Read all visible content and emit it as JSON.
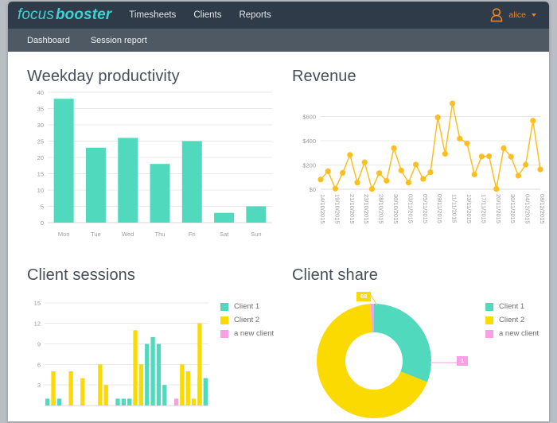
{
  "colors": {
    "teal": "#51d9bd",
    "yellow": "#fada00",
    "pink": "#f99fe6",
    "navbar": "#2f3b49",
    "subnav": "#4e5964",
    "brand": "#3fd0d4",
    "user_accent": "#e8832a",
    "title": "#454f59",
    "grid": "#e8e8e8"
  },
  "header": {
    "logo_first": "focus",
    "logo_second": "booster",
    "nav": [
      {
        "label": "Timesheets"
      },
      {
        "label": "Clients"
      },
      {
        "label": "Reports"
      }
    ],
    "user": {
      "name": "alice",
      "avatar_icon": "user-icon",
      "caret_icon": "chevron-down-icon"
    }
  },
  "subnav": {
    "items": [
      {
        "label": "Dashboard"
      },
      {
        "label": "Session report"
      }
    ]
  },
  "chart_data": [
    {
      "type": "bar",
      "panel": "weekday-productivity",
      "title": "Weekday productivity",
      "categories": [
        "Mon",
        "Tue",
        "Wed",
        "Thu",
        "Fri",
        "Sat",
        "Sun"
      ],
      "values": [
        38,
        23,
        26,
        18,
        25,
        3,
        5
      ],
      "yticks": [
        0,
        5,
        10,
        15,
        20,
        25,
        30,
        35,
        40
      ],
      "ylim": [
        0,
        40
      ],
      "xlabel": "",
      "ylabel": "",
      "color": "#51d9bd",
      "grid": true,
      "legend": "none"
    },
    {
      "type": "line",
      "panel": "revenue",
      "title": "Revenue",
      "x": [
        "14/10/2015",
        "19/10/2015",
        "21/10/2015",
        "23/10/2015",
        "28/10/2015",
        "30/10/2015",
        "03/11/2015",
        "05/11/2015",
        "09/11/2015",
        "11/11/2015",
        "13/11/2015",
        "17/11/2015",
        "20/11/2015",
        "30/11/2015",
        "04/12/2015",
        "08/12/2015"
      ],
      "values": [
        80,
        148,
        5,
        135,
        283,
        55,
        222,
        2,
        133,
        70,
        338,
        155,
        55,
        203,
        85,
        140,
        592,
        292,
        707,
        417,
        378,
        122,
        270,
        272,
        2,
        338,
        268,
        112,
        203,
        565,
        163
      ],
      "yticks": [
        0,
        200,
        400,
        600
      ],
      "yticklabels": [
        "$0",
        "$200",
        "$400",
        "$600"
      ],
      "ylim": [
        0,
        760
      ],
      "color": "#fbbf1f",
      "marker": "circle",
      "grid": true,
      "legend": "none"
    },
    {
      "type": "bar",
      "panel": "client-sessions",
      "title": "Client sessions",
      "yticks": [
        3,
        6,
        9,
        12,
        15
      ],
      "ylim": [
        0,
        15.8
      ],
      "grid": true,
      "legend": "right",
      "series": [
        {
          "name": "Client 1",
          "color": "#51d9bd",
          "values": [
            1,
            1,
            1,
            0,
            0,
            0,
            0,
            0,
            0,
            0,
            0,
            0,
            1,
            1,
            1,
            0,
            3,
            9,
            10,
            9,
            3,
            0,
            0,
            0,
            0,
            0,
            4,
            4
          ]
        },
        {
          "name": "Client 2",
          "color": "#fada00",
          "values": [
            0,
            5,
            0,
            0,
            5,
            0,
            4,
            0,
            0,
            6,
            3,
            0,
            0,
            0,
            0,
            11,
            6,
            0,
            0,
            0,
            0,
            0,
            0,
            6,
            5,
            1,
            12,
            0
          ]
        },
        {
          "name": "a new client",
          "color": "#f99fe6",
          "values": [
            0,
            0,
            0,
            0,
            0,
            0,
            0,
            0,
            0,
            0,
            0,
            0,
            0,
            0,
            0,
            0,
            0,
            0,
            0,
            0,
            0,
            0,
            1,
            0,
            0,
            0,
            0,
            0
          ]
        }
      ]
    },
    {
      "type": "pie",
      "panel": "client-share",
      "title": "Client share",
      "variant": "donut",
      "labels": [
        "Client 1",
        "Client 2",
        "a new client"
      ],
      "values": [
        31,
        68,
        1
      ],
      "colors": [
        "#51d9bd",
        "#fada00",
        "#f99fe6"
      ],
      "data_labels": [
        {
          "text": "68",
          "slice": "Client 2",
          "bg": "#fada00"
        },
        {
          "text": "1",
          "slice": "a new client",
          "bg": "#f99fe6"
        }
      ],
      "legend": "right"
    }
  ],
  "legends": {
    "client_sessions": [
      {
        "label": "Client 1",
        "color": "#51d9bd"
      },
      {
        "label": "Client 2",
        "color": "#fada00"
      },
      {
        "label": "a new client",
        "color": "#f99fe6"
      }
    ],
    "client_share": [
      {
        "label": "Client 1",
        "color": "#51d9bd"
      },
      {
        "label": "Client 2",
        "color": "#fada00"
      },
      {
        "label": "a new client",
        "color": "#f99fe6"
      }
    ]
  }
}
